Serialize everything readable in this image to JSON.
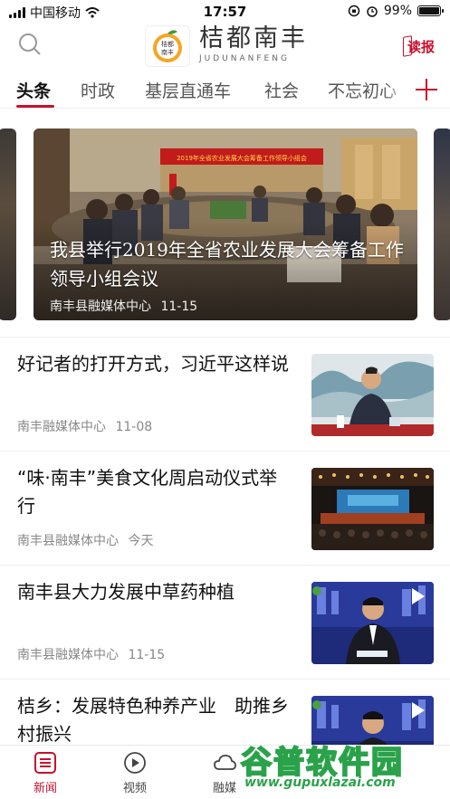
{
  "status_bar": {
    "carrier": "中国移动",
    "time": "17:57",
    "battery": "99%",
    "battery_level": 0.99
  },
  "header": {
    "logo_badge": "桔都南丰",
    "title": "桔都南丰",
    "subtitle": "JUDUNANFENG",
    "read_label": "读报"
  },
  "tabs": [
    "头条",
    "时政",
    "基层直通车",
    "社会",
    "不忘初心"
  ],
  "featured": {
    "title": "我县举行2019年全省农业发展大会筹备工作领导小组会议",
    "source": "南丰县融媒体中心",
    "date": "11-15",
    "banner_text": "2019年全省农业发展大会筹备工作领导小组会"
  },
  "news": [
    {
      "title": "好记者的打开方式，习近平这样说",
      "source": "南丰融媒体中心",
      "date": "11-08",
      "thumb": "leader-photo",
      "video": false
    },
    {
      "title": "“味·南丰”美食文化周启动仪式举行",
      "source": "南丰县融媒体中心",
      "date": "今天",
      "thumb": "stage-photo",
      "video": false
    },
    {
      "title": "南丰县大力发展中草药种植",
      "source": "南丰县融媒体中心",
      "date": "11-15",
      "thumb": "anchor-video",
      "video": true
    },
    {
      "title": "桔乡：发展特色种养产业　助推乡村振兴",
      "source": "",
      "date": "",
      "thumb": "anchor-video",
      "video": true
    }
  ],
  "bottom_nav": [
    {
      "label": "新闻",
      "icon": "news-list-icon",
      "active": true
    },
    {
      "label": "视频",
      "icon": "play-circle-icon",
      "active": false
    },
    {
      "label": "融媒",
      "icon": "cloud-icon",
      "active": false
    }
  ],
  "watermark": {
    "text": "谷普软件园",
    "url": "www.gupuxlazai.com"
  },
  "colors": {
    "accent": "#c8102e",
    "text": "#111111",
    "meta": "#888888"
  }
}
